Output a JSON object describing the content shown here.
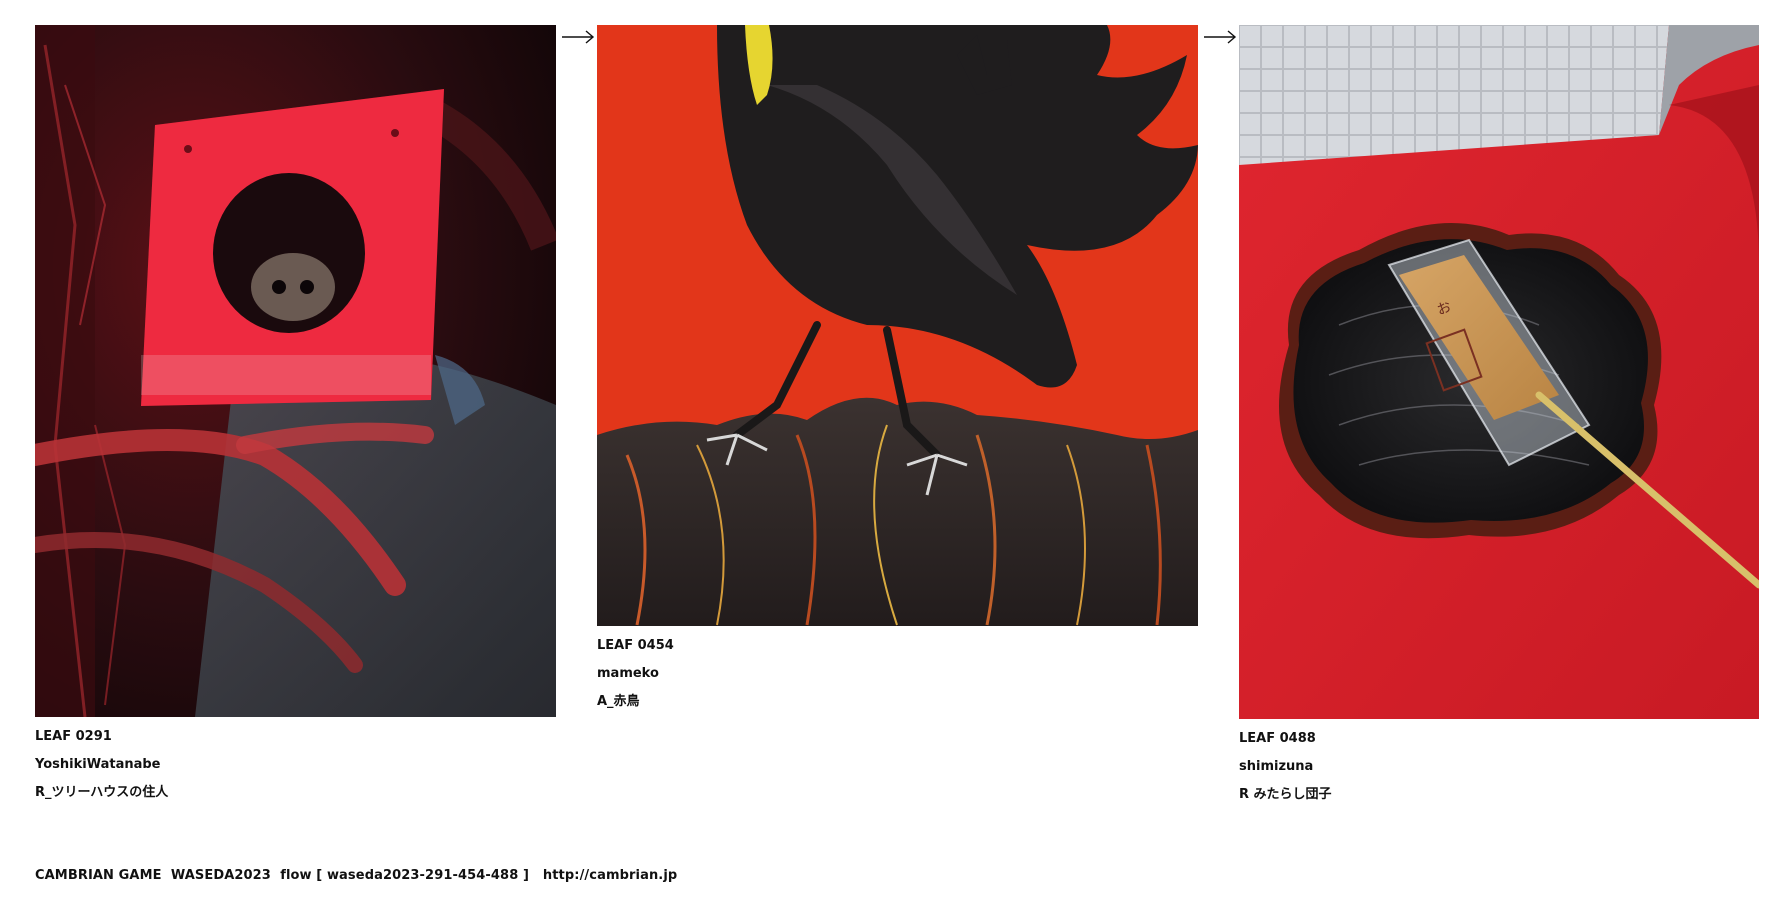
{
  "leaves": [
    {
      "id": "LEAF 0291",
      "author": "YoshikiWatanabe",
      "title": "R_ツリーハウスの住人"
    },
    {
      "id": "LEAF 0454",
      "author": "mameko",
      "title": "A_赤鳥"
    },
    {
      "id": "LEAF 0488",
      "author": "shimizuna",
      "title": "R みたらし団子"
    }
  ],
  "arrows": [
    "arrow-right-icon",
    "arrow-right-icon"
  ],
  "footer": {
    "text": "CAMBRIAN GAME  WASEDA2023  flow [ waseda2023-291-454-488 ]   ",
    "link": "http://cambrian.jp"
  },
  "colors": {
    "background": "#ffffff",
    "text": "#111111",
    "crow_bg": "#e2361a",
    "felt_red": "#d81e2a"
  }
}
